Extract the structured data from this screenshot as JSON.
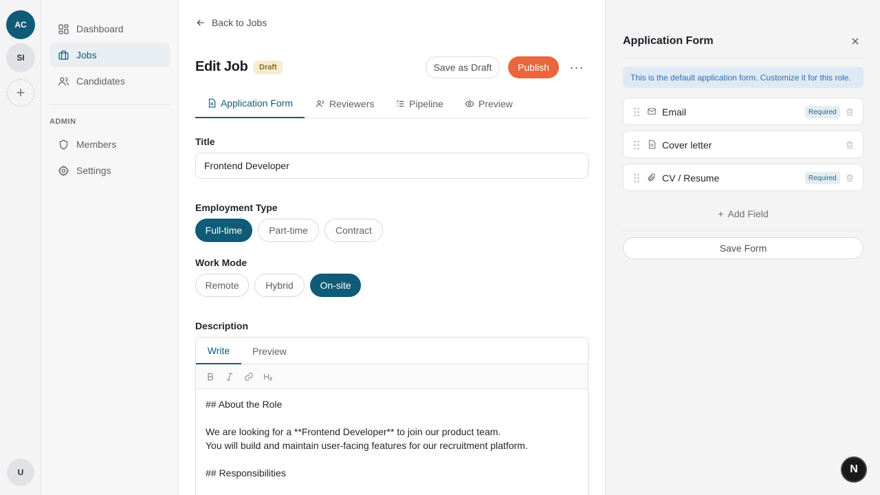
{
  "workspaces": [
    {
      "initials": "AC",
      "color": "#0f5b78"
    },
    {
      "initials": "SI",
      "color": "#e1e2e5"
    }
  ],
  "add_workspace_symbol": "+",
  "user_avatar": "U",
  "sidebar": {
    "items": [
      {
        "label": "Dashboard",
        "icon": "dashboard-icon",
        "active": false
      },
      {
        "label": "Jobs",
        "icon": "briefcase-icon",
        "active": true
      },
      {
        "label": "Candidates",
        "icon": "users-icon",
        "active": false
      }
    ],
    "admin_heading": "ADMIN",
    "admin_items": [
      {
        "label": "Members",
        "icon": "shield-icon"
      },
      {
        "label": "Settings",
        "icon": "gear-icon"
      }
    ]
  },
  "header": {
    "back_label": "Back to Jobs",
    "title": "Edit Job",
    "status_badge": "Draft",
    "save_draft_label": "Save as Draft",
    "publish_label": "Publish",
    "more_symbol": "···"
  },
  "tabs": [
    {
      "label": "Application Form",
      "icon": "file-icon",
      "active": true
    },
    {
      "label": "Reviewers",
      "icon": "users-icon",
      "active": false
    },
    {
      "label": "Pipeline",
      "icon": "list-icon",
      "active": false
    },
    {
      "label": "Preview",
      "icon": "eye-icon",
      "active": false
    }
  ],
  "form": {
    "title_label": "Title",
    "title_value": "Frontend Developer",
    "employment_label": "Employment Type",
    "employment_options": [
      "Full-time",
      "Part-time",
      "Contract"
    ],
    "employment_selected": "Full-time",
    "workmode_label": "Work Mode",
    "workmode_options": [
      "Remote",
      "Hybrid",
      "On-site"
    ],
    "workmode_selected": "On-site",
    "description_label": "Description",
    "editor_tabs": [
      "Write",
      "Preview"
    ],
    "editor_active_tab": "Write",
    "toolbar": [
      {
        "icon": "bold-icon"
      },
      {
        "icon": "italic-icon"
      },
      {
        "icon": "link-icon"
      },
      {
        "icon": "heading-icon"
      }
    ],
    "description_lines": [
      "## About the Role",
      "",
      "We are looking for a **Frontend Developer** to join our product team.",
      "You will build and maintain user-facing features for our recruitment platform.",
      "",
      "## Responsibilities"
    ]
  },
  "panel": {
    "title": "Application Form",
    "info_text": "This is the default application form. Customize it for this role.",
    "fields": [
      {
        "label": "Email",
        "icon": "mail-icon",
        "required": true
      },
      {
        "label": "Cover letter",
        "icon": "document-icon",
        "required": false
      },
      {
        "label": "CV / Resume",
        "icon": "paperclip-icon",
        "required": true
      }
    ],
    "required_label": "Required",
    "add_field_label": "Add Field",
    "save_label": "Save Form"
  },
  "corner_badge": "N",
  "colors": {
    "brand": "#0f5b78",
    "publish": "#e9663f",
    "draft_badge": "#f6ecd2",
    "info_bg": "#dfe9f4"
  }
}
